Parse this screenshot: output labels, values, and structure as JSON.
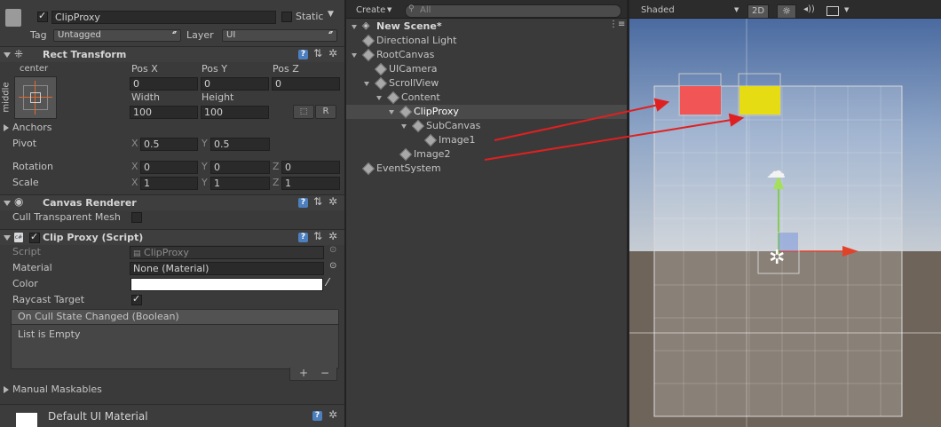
{
  "inspector": {
    "object_name": "ClipProxy",
    "static_label": "Static",
    "tag_label": "Tag",
    "tag_value": "Untagged",
    "layer_label": "Layer",
    "layer_value": "UI",
    "rect_transform": {
      "title": "Rect Transform",
      "anchor_h": "center",
      "anchor_v": "middle",
      "pos_x_label": "Pos X",
      "pos_y_label": "Pos Y",
      "pos_z_label": "Pos Z",
      "pos_x": "0",
      "pos_y": "0",
      "pos_z": "0",
      "width_label": "Width",
      "height_label": "Height",
      "width": "100",
      "height": "100",
      "r_button": "R",
      "anchors_label": "Anchors",
      "pivot_label": "Pivot",
      "pivot_x": "0.5",
      "pivot_y": "0.5",
      "rotation_label": "Rotation",
      "rot_x": "0",
      "rot_y": "0",
      "rot_z": "0",
      "scale_label": "Scale",
      "scale_x": "1",
      "scale_y": "1",
      "scale_z": "1",
      "x": "X",
      "y": "Y",
      "z": "Z"
    },
    "canvas_renderer": {
      "title": "Canvas Renderer",
      "cull_label": "Cull Transparent Mesh"
    },
    "clip_proxy": {
      "title": "Clip Proxy (Script)",
      "script_label": "Script",
      "script_value": "ClipProxy",
      "material_label": "Material",
      "material_value": "None (Material)",
      "color_label": "Color",
      "color_value": "#ffffff",
      "raycast_label": "Raycast Target",
      "event_title": "On Cull State Changed (Boolean)",
      "event_empty": "List is Empty",
      "add": "+",
      "remove": "−",
      "manual_maskables": "Manual Maskables"
    },
    "material_footer": "Default UI Material"
  },
  "hierarchy": {
    "create_label": "Create",
    "search_placeholder": "All",
    "scene_name": "New Scene*",
    "items": [
      {
        "label": "Directional Light",
        "depth": 1,
        "expanded": null
      },
      {
        "label": "RootCanvas",
        "depth": 1,
        "expanded": true
      },
      {
        "label": "UICamera",
        "depth": 2,
        "expanded": null
      },
      {
        "label": "ScrollView",
        "depth": 2,
        "expanded": true
      },
      {
        "label": "Content",
        "depth": 3,
        "expanded": true
      },
      {
        "label": "ClipProxy",
        "depth": 4,
        "expanded": true,
        "selected": true
      },
      {
        "label": "SubCanvas",
        "depth": 5,
        "expanded": true
      },
      {
        "label": "Image1",
        "depth": 6,
        "expanded": null
      },
      {
        "label": "Image2",
        "depth": 4,
        "expanded": null
      },
      {
        "label": "EventSystem",
        "depth": 1,
        "expanded": null
      }
    ]
  },
  "scene": {
    "shading_mode": "Shaded",
    "mode_2d": "2D",
    "colors": {
      "red_image": "#f25555",
      "yellow_image": "#e6dc14",
      "sky": "#5a7bb0",
      "ground": "#6e6358",
      "arrow": "#e02020"
    }
  }
}
